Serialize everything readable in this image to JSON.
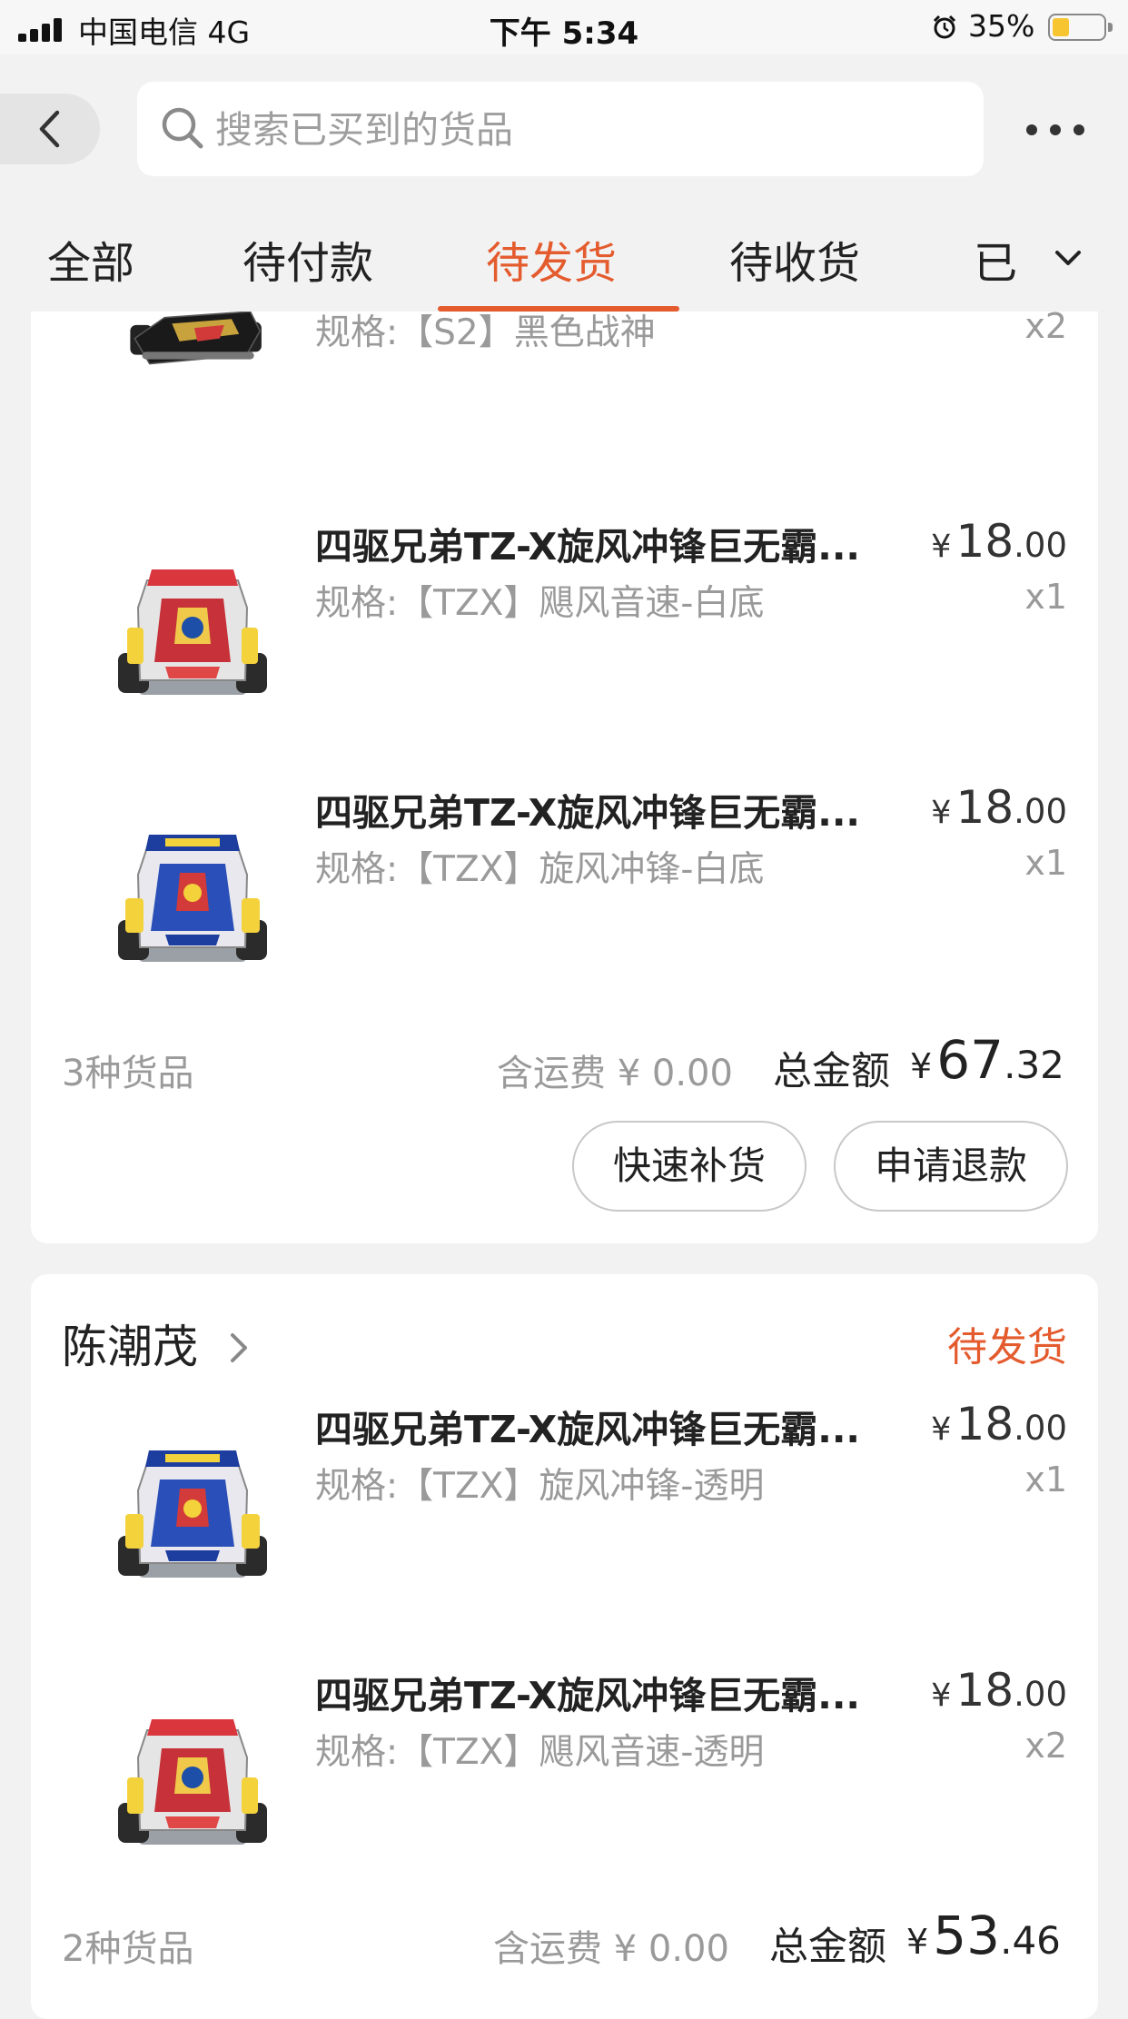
{
  "status_bar": {
    "carrier": "中国电信   4G",
    "time": "下午 5:34",
    "battery_pct": "35%",
    "battery_level": 0.35
  },
  "nav": {
    "search_placeholder": "搜索已买到的货品"
  },
  "tabs": [
    "全部",
    "待付款",
    "待发货",
    "待收货",
    "已"
  ],
  "active_tab": 2,
  "colors": {
    "accent": "#e45b2e",
    "background": "#f2f2f2",
    "card": "#ffffff",
    "muted_text": "#9a9a9a"
  },
  "orders": [
    {
      "items": [
        {
          "spec": "规格:【S2】黑色战神",
          "qty": "x2",
          "thumb": "black-car"
        },
        {
          "name": "四驱兄弟TZ-X旋风冲锋巨无霸...",
          "spec": "规格:【TZX】飓风音速-白底",
          "price_currency": "¥",
          "price_int": "18",
          "price_dec": ".00",
          "qty": "x1",
          "thumb": "red-car"
        },
        {
          "name": "四驱兄弟TZ-X旋风冲锋巨无霸...",
          "spec": "规格:【TZX】旋风冲锋-白底",
          "price_currency": "¥",
          "price_int": "18",
          "price_dec": ".00",
          "qty": "x1",
          "thumb": "blue-car"
        }
      ],
      "count_text": "3种货品",
      "shipping_text": "含运费 ¥ 0.00",
      "total_label": "总金额",
      "total_currency": "¥",
      "total_int": "67",
      "total_dec": ".32",
      "buttons": [
        "快速补货",
        "申请退款"
      ]
    },
    {
      "seller": "陈潮茂",
      "status": "待发货",
      "items": [
        {
          "name": "四驱兄弟TZ-X旋风冲锋巨无霸...",
          "spec": "规格:【TZX】旋风冲锋-透明",
          "price_currency": "¥",
          "price_int": "18",
          "price_dec": ".00",
          "qty": "x1",
          "thumb": "blue-car"
        },
        {
          "name": "四驱兄弟TZ-X旋风冲锋巨无霸...",
          "spec": "规格:【TZX】飓风音速-透明",
          "price_currency": "¥",
          "price_int": "18",
          "price_dec": ".00",
          "qty": "x2",
          "thumb": "red-car"
        }
      ],
      "count_text": "2种货品",
      "shipping_text": "含运费 ¥ 0.00",
      "total_label": "总金额",
      "total_currency": "¥",
      "total_int": "53",
      "total_dec": ".46"
    }
  ]
}
